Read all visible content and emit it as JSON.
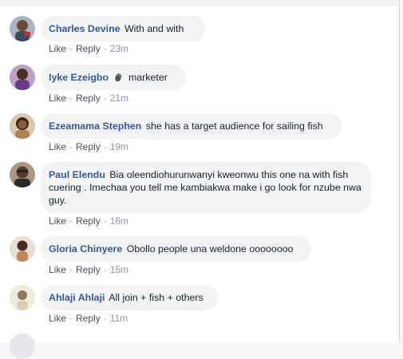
{
  "comments": [
    {
      "author": "Charles Devine",
      "text": "With and with",
      "like": "Like",
      "reply": "Reply",
      "time": "23m",
      "avatar_color": "#7a8aa0"
    },
    {
      "author": "Iyke Ezeigbo",
      "text": "marketer",
      "emoji": "waving-hand-icon",
      "like": "Like",
      "reply": "Reply",
      "time": "21m",
      "avatar_color": "#5a3a7a"
    },
    {
      "author": "Ezeamama Stephen",
      "text": "she has a target audience for sailing fish",
      "like": "Like",
      "reply": "Reply",
      "time": "19m",
      "avatar_color": "#8a5a3a"
    },
    {
      "author": "Paul Elendu",
      "text": "Bia oleendiohurunwanyi kweonwu this one na with fish cuering . Imechaa you tell me kambiakwa make i go look for nzube nwa guy.",
      "like": "Like",
      "reply": "Reply",
      "time": "16m",
      "avatar_color": "#6a4a3a"
    },
    {
      "author": "Gloria Chinyere",
      "text": "Obollo people una weldone oooooooo",
      "like": "Like",
      "reply": "Reply",
      "time": "15m",
      "avatar_color": "#c9a070"
    },
    {
      "author": "Ahlaji Ahlaji",
      "text": "All join + fish + others",
      "like": "Like",
      "reply": "Reply",
      "time": "11m",
      "avatar_color": "#e0d8c0"
    }
  ],
  "colors": {
    "author": "#385898",
    "bubble": "#f2f3f5",
    "meta": "#90949c"
  }
}
